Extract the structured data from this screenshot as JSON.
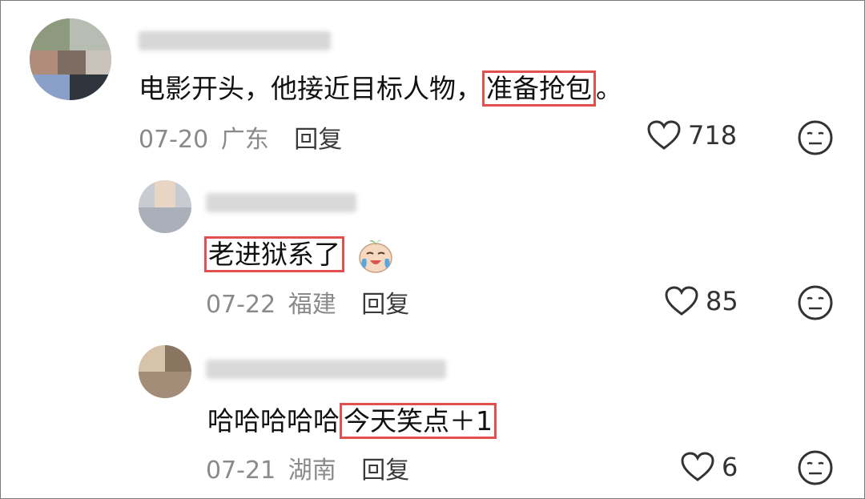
{
  "comments": [
    {
      "text_plain": "电影开头，他接近目标人物，",
      "text_highlight": "准备抢包",
      "text_tail": "。",
      "date": "07-20",
      "location": "广东",
      "reply_label": "回复",
      "likes": "718"
    },
    {
      "text_plain": "",
      "text_highlight": "老进狱系了",
      "text_tail": "",
      "date": "07-22",
      "location": "福建",
      "reply_label": "回复",
      "likes": "85"
    },
    {
      "text_plain": "哈哈哈哈哈",
      "text_highlight": "今天笑点＋1",
      "text_tail": "",
      "date": "07-21",
      "location": "湖南",
      "reply_label": "回复",
      "likes": "6"
    }
  ],
  "colors": {
    "highlight_border": "#e0504f",
    "meta_text": "#8a8a8a",
    "icon": "#333333"
  },
  "icons": {
    "like": "heart-outline-icon",
    "reaction": "neutral-face-icon",
    "emoji": "laughing-crying-emoji"
  }
}
